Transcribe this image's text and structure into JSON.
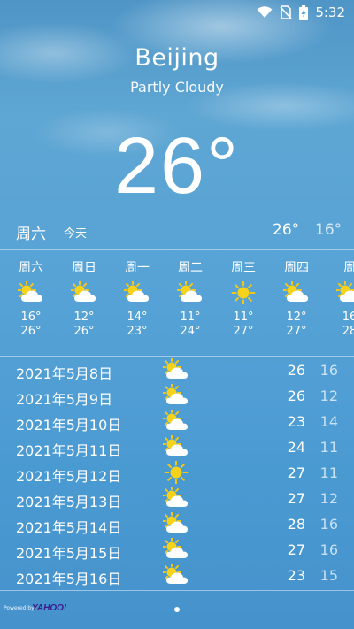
{
  "status_bar": {
    "time": "5:32"
  },
  "location": {
    "city": "Beijing",
    "condition": "Partly Cloudy"
  },
  "current": {
    "temperature": "26°"
  },
  "today": {
    "day": "周六",
    "label": "今天",
    "high": "26°",
    "low": "16°"
  },
  "hourly": [
    {
      "day": "周六",
      "icon": "partly-cloudy-icon",
      "low": "16°",
      "high": "26°"
    },
    {
      "day": "周日",
      "icon": "partly-cloudy-icon",
      "low": "12°",
      "high": "26°"
    },
    {
      "day": "周一",
      "icon": "partly-cloudy-icon",
      "low": "14°",
      "high": "23°"
    },
    {
      "day": "周二",
      "icon": "partly-cloudy-icon",
      "low": "11°",
      "high": "24°"
    },
    {
      "day": "周三",
      "icon": "sunny-icon",
      "low": "11°",
      "high": "27°"
    },
    {
      "day": "周四",
      "icon": "partly-cloudy-icon",
      "low": "12°",
      "high": "27°"
    },
    {
      "day": "周",
      "icon": "partly-cloudy-icon",
      "low": "16",
      "high": "28"
    }
  ],
  "daily": [
    {
      "date": "2021年5月8日",
      "icon": "partly-cloudy-icon",
      "high": "26",
      "low": "16"
    },
    {
      "date": "2021年5月9日",
      "icon": "partly-cloudy-icon",
      "high": "26",
      "low": "12"
    },
    {
      "date": "2021年5月10日",
      "icon": "partly-cloudy-icon",
      "high": "23",
      "low": "14"
    },
    {
      "date": "2021年5月11日",
      "icon": "partly-cloudy-icon",
      "high": "24",
      "low": "11"
    },
    {
      "date": "2021年5月12日",
      "icon": "sunny-icon",
      "high": "27",
      "low": "11"
    },
    {
      "date": "2021年5月13日",
      "icon": "partly-cloudy-icon",
      "high": "27",
      "low": "12"
    },
    {
      "date": "2021年5月14日",
      "icon": "partly-cloudy-icon",
      "high": "28",
      "low": "16"
    },
    {
      "date": "2021年5月15日",
      "icon": "partly-cloudy-icon",
      "high": "27",
      "low": "16"
    },
    {
      "date": "2021年5月16日",
      "icon": "partly-cloudy-icon",
      "high": "23",
      "low": "15"
    }
  ],
  "footer": {
    "powered_by": "Powered by",
    "brand": "YAHOO!"
  },
  "colors": {
    "sun": "#f6d21a",
    "sun_ray": "#f3c714",
    "cloud": "#ffffff",
    "sky": "#57a3d6"
  }
}
